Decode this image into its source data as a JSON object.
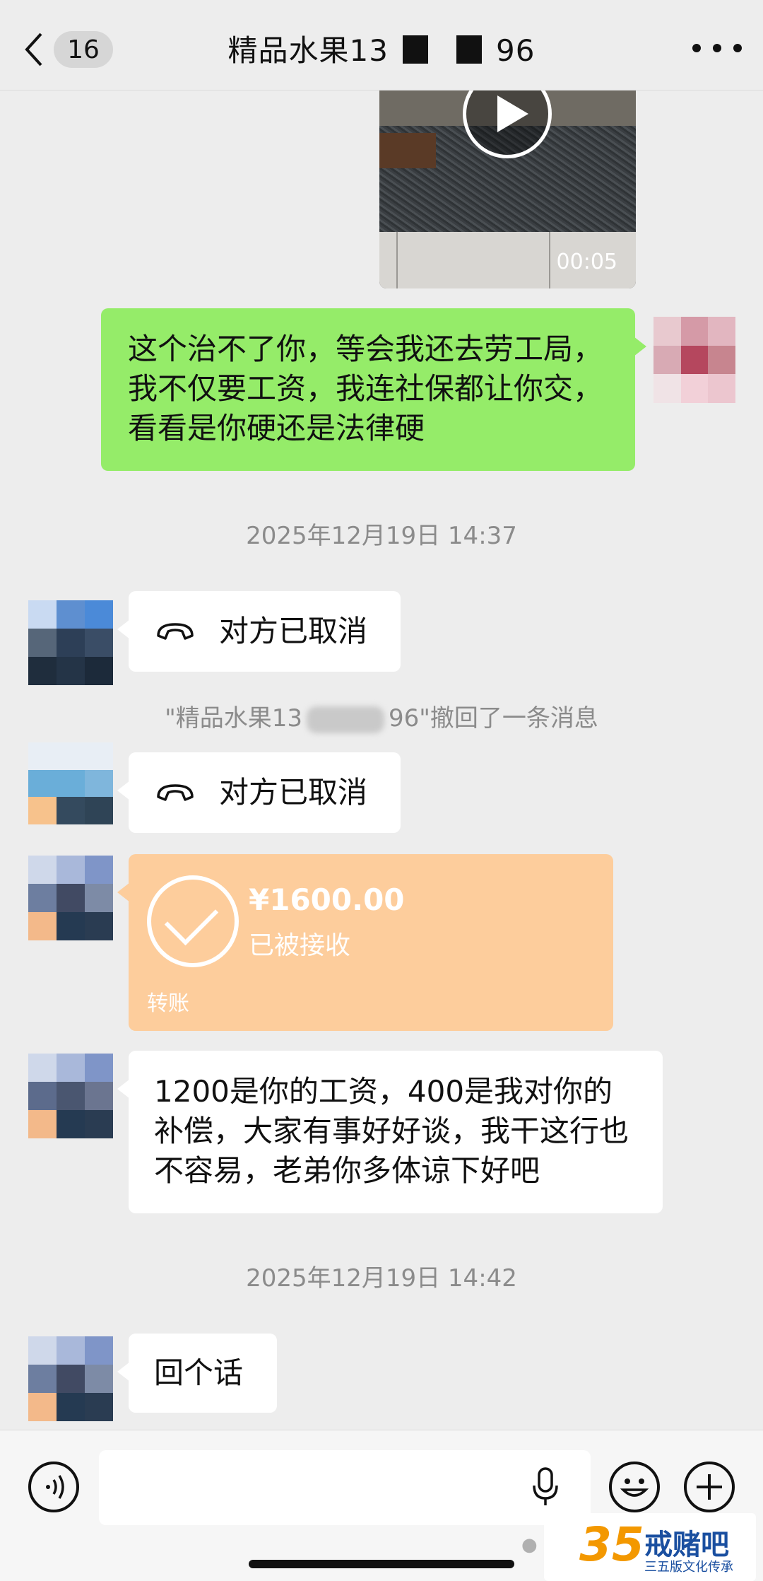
{
  "header": {
    "back_count": "16",
    "title_left": "精品水果13",
    "title_right": "96"
  },
  "video": {
    "duration": "00:05"
  },
  "messages": {
    "sent_text": "这个治不了你，等会我还去劳工局，我不仅要工资，我连社保都让你交，看看是你硬还是法律硬",
    "timestamp1": "2025年12月19日 14:37",
    "call1": "对方已取消",
    "recall_left": "\"精品水果13",
    "recall_right": "96\"撤回了一条消息",
    "call2": "对方已取消",
    "transfer_amount": "¥1600.00",
    "transfer_status": "已被接收",
    "transfer_label": "转账",
    "received_text": "1200是你的工资，400是我对你的补偿，大家有事好好谈，我干这行也不容易，老弟你多体谅下好吧",
    "timestamp2": "2025年12月19日 14:42",
    "last_text": "回个话"
  },
  "watermark": {
    "number": "35",
    "name": "戒赌吧",
    "sub": "三五版文化传承"
  },
  "colors": {
    "sent_bubble": "#95ec69",
    "transfer": "#fdcd9c",
    "background": "#ededed"
  }
}
